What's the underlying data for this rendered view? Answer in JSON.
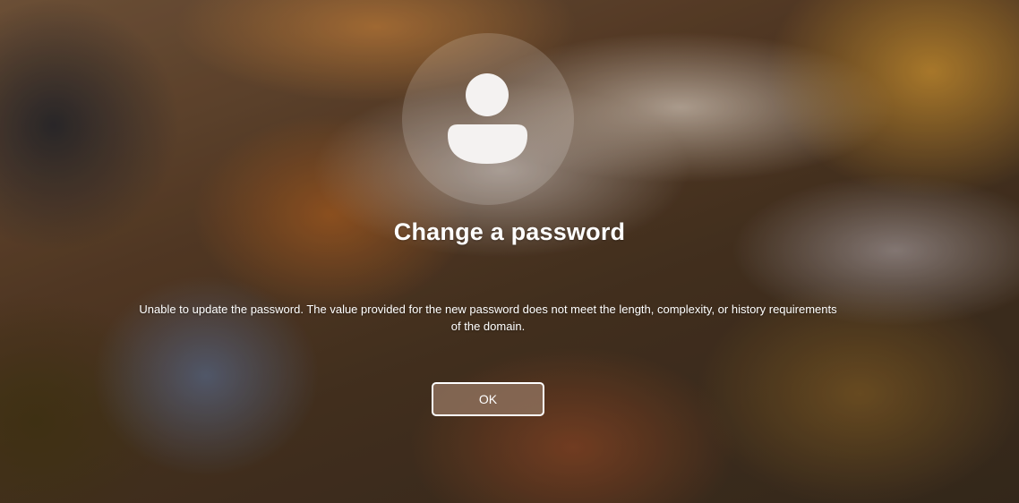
{
  "dialog": {
    "title": "Change a password",
    "message": "Unable to update the password. The value provided for the new password does not meet the length, complexity, or history requirements of the domain.",
    "ok_label": "OK"
  },
  "icons": {
    "avatar": "user-silhouette-icon"
  },
  "colors": {
    "text": "#ffffff",
    "button_border": "#ffffff",
    "avatar_glyph": "#f4f2f1"
  }
}
